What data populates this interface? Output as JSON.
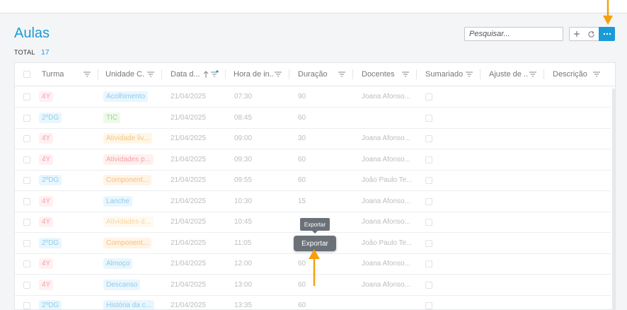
{
  "page": {
    "title": "Aulas",
    "total_label": "TOTAL",
    "total_count": "17"
  },
  "toolbar": {
    "search_placeholder": "Pesquisar...",
    "add_icon": "plus-icon",
    "refresh_icon": "refresh-icon",
    "more_icon": "more-dots-icon"
  },
  "columns": [
    {
      "label": "Turma"
    },
    {
      "label": "Unidade C..."
    },
    {
      "label": "Data d..."
    },
    {
      "label": "Hora de in..."
    },
    {
      "label": "Duração"
    },
    {
      "label": "Docentes"
    },
    {
      "label": "Sumariado"
    },
    {
      "label": "Ajuste de ..."
    },
    {
      "label": "Descrição"
    }
  ],
  "rows": [
    {
      "turma": "4Y",
      "unidade": "Acolhimento",
      "data": "21/04/2025",
      "hora": "07:30",
      "duracao": "90",
      "docentes": "Joana Afonso..."
    },
    {
      "turma": "2ºDG",
      "unidade": "TIC",
      "data": "21/04/2025",
      "hora": "08:45",
      "duracao": "60",
      "docentes": ""
    },
    {
      "turma": "4Y",
      "unidade": "Atividade liv...",
      "data": "21/04/2025",
      "hora": "09:00",
      "duracao": "30",
      "docentes": "Joana Afonso..."
    },
    {
      "turma": "4Y",
      "unidade": "Atividades p...",
      "data": "21/04/2025",
      "hora": "09:30",
      "duracao": "60",
      "docentes": "Joana Afonso..."
    },
    {
      "turma": "2ºDG",
      "unidade": "Component...",
      "data": "21/04/2025",
      "hora": "09:55",
      "duracao": "60",
      "docentes": "João Paulo Te..."
    },
    {
      "turma": "4Y",
      "unidade": "Lanche",
      "data": "21/04/2025",
      "hora": "10:30",
      "duracao": "15",
      "docentes": "Joana Afonso..."
    },
    {
      "turma": "4Y",
      "unidade": "Atividades d...",
      "data": "21/04/2025",
      "hora": "10:45",
      "duracao": "",
      "docentes": "Joana Afonso..."
    },
    {
      "turma": "2ºDG",
      "unidade": "Component...",
      "data": "21/04/2025",
      "hora": "11:05",
      "duracao": "",
      "docentes": "João Paulo Te..."
    },
    {
      "turma": "4Y",
      "unidade": "Almoço",
      "data": "21/04/2025",
      "hora": "12:00",
      "duracao": "60",
      "docentes": "Joana Afonso..."
    },
    {
      "turma": "4Y",
      "unidade": "Descanso",
      "data": "21/04/2025",
      "hora": "13:00",
      "duracao": "60",
      "docentes": "Joana Afonso..."
    },
    {
      "turma": "2ºDG",
      "unidade": "História da c...",
      "data": "21/04/2025",
      "hora": "13:35",
      "duracao": "60",
      "docentes": ""
    }
  ],
  "chip_styles": {
    "4Y": {
      "bg": "#fff0f2",
      "fg": "#f5a3ad"
    },
    "2ºDG": {
      "bg": "#e9f6fd",
      "fg": "#8fcfee"
    },
    "Acolhimento": {
      "bg": "#eaf6fd",
      "fg": "#8ccdee"
    },
    "TIC": {
      "bg": "#eef9ea",
      "fg": "#9bd68a"
    },
    "Atividade liv...": {
      "bg": "#fff6e6",
      "fg": "#f4c77e"
    },
    "Atividades p...": {
      "bg": "#fff0f0",
      "fg": "#f3a3a8"
    },
    "Component...": {
      "bg": "#fff4e6",
      "fg": "#f6bf7d"
    },
    "Lanche": {
      "bg": "#eaf6fd",
      "fg": "#8ccdee"
    },
    "Atividades d...": {
      "bg": "#fff9ee",
      "fg": "#f6d6a4"
    },
    "Almoço": {
      "bg": "#eaf6fd",
      "fg": "#8ccdee"
    },
    "Descanso": {
      "bg": "#eaf6fd",
      "fg": "#8ccdee"
    },
    "História da c...": {
      "bg": "#eaf6fd",
      "fg": "#8ccdee"
    }
  },
  "overlay": {
    "tooltip_text": "Exportar",
    "export_label": "Exportar"
  },
  "colors": {
    "accent": "#1a9bd7",
    "annotation_arrow": "#f5a00b",
    "tooltip_bg": "#6b7178"
  }
}
